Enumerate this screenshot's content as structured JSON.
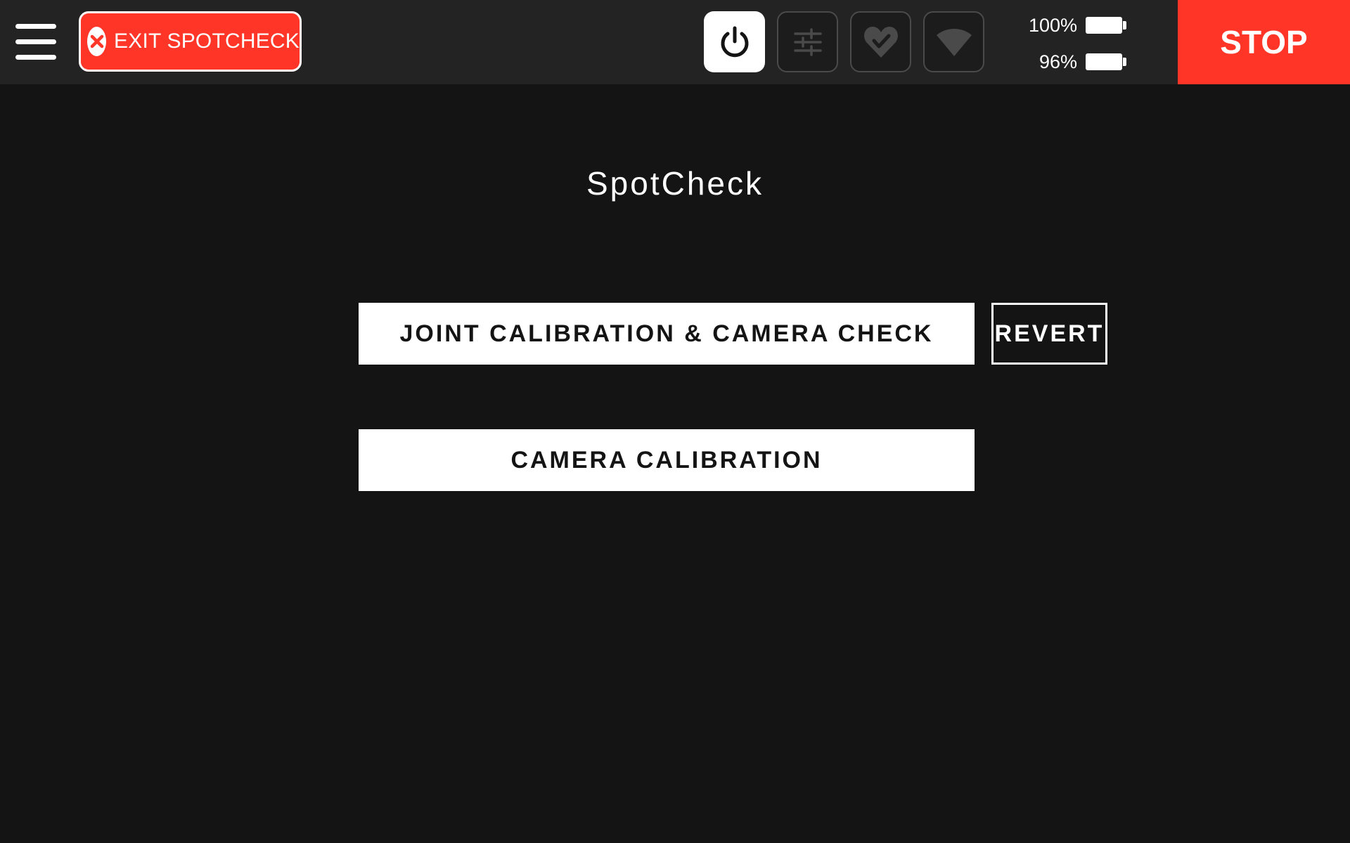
{
  "header": {
    "menu_icon": "hamburger-menu-icon",
    "exit_button_label": "EXIT SPOTCHECK",
    "exit_icon": "close-circle-icon",
    "status_icons": [
      {
        "name": "power-icon",
        "active": true
      },
      {
        "name": "sliders-icon",
        "active": false
      },
      {
        "name": "heart-check-icon",
        "active": false
      },
      {
        "name": "wifi-icon",
        "active": false
      }
    ],
    "batteries": [
      {
        "percent": "100%",
        "level": 1.0
      },
      {
        "percent": "96%",
        "level": 0.96
      }
    ],
    "stop_label": "STOP"
  },
  "main": {
    "title": "SpotCheck",
    "buttons": [
      {
        "label": "JOINT CALIBRATION & CAMERA CHECK"
      },
      {
        "label": "CAMERA CALIBRATION"
      }
    ],
    "revert_label": "REVERT"
  },
  "colors": {
    "background": "#141414",
    "topbar": "#232323",
    "accent_red": "#ff3527",
    "button_white": "#ffffff"
  }
}
